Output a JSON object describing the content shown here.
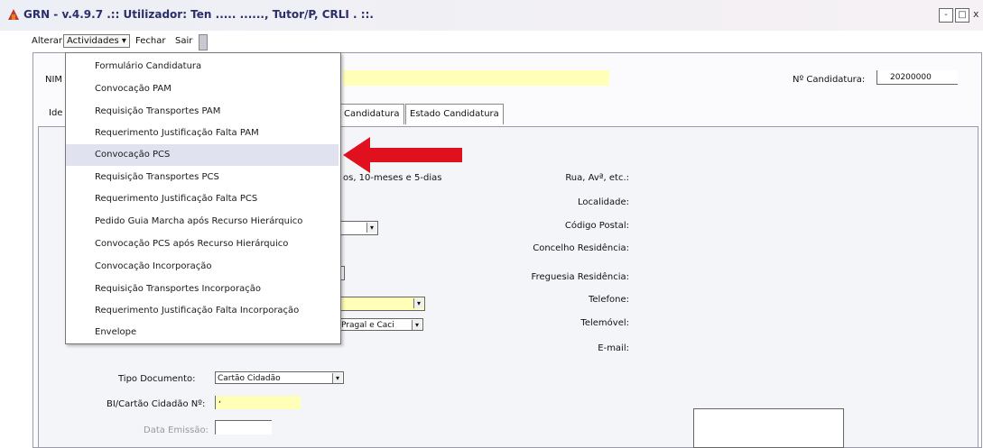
{
  "window": {
    "title": "GRN - v.4.9.7 .:: Utilizador: Ten ..... ......, Tutor/P, CRLI . ::.",
    "min_label": "-",
    "max_label": "□",
    "close_label": "x"
  },
  "menubar": {
    "alterar": "Alterar",
    "actividades": "Actividades ▾",
    "fechar": "Fechar",
    "sair": "Sair"
  },
  "header": {
    "nim_label": "NIM",
    "candidatura_label": "Nº Candidatura:",
    "candidatura_value": "20200000"
  },
  "tabs": [
    {
      "label": "Ide"
    },
    {
      "label": "Candidatura"
    },
    {
      "label": "Estado Candidatura"
    }
  ],
  "dropdown": {
    "items": [
      {
        "label": "Formulário Candidatura"
      },
      {
        "label": "Convocação PAM"
      },
      {
        "label": "Requisição Transportes PAM"
      },
      {
        "label": "Requerimento Justificação Falta PAM"
      },
      {
        "label": "Convocação PCS",
        "selected": true
      },
      {
        "label": "Requisição Transportes PCS"
      },
      {
        "label": "Requerimento Justificação Falta PCS"
      },
      {
        "label": "Pedido Guia Marcha após Recurso Hierárquico"
      },
      {
        "label": "Convocação PCS após Recurso Hierárquico"
      },
      {
        "label": "Convocação Incorporação"
      },
      {
        "label": "Requisição Transportes Incorporação"
      },
      {
        "label": "Requerimento Justificação Falta Incorporação"
      },
      {
        "label": "Envelope"
      }
    ]
  },
  "form": {
    "age_text": "os, 10-meses e 5-dias",
    "right_labels": [
      "Rua, Avª, etc.:",
      "Localidade:",
      "Código Postal:",
      "Concelho Residência:",
      "Freguesia Residência:",
      "Telefone:",
      "Telemóvel:",
      "E-mail:"
    ],
    "parish_value": "Pragal e Caci",
    "tipo_documento_label": "Tipo Documento:",
    "tipo_documento_value": "Cartão Cidadão",
    "bi_label": "BI/Cartão Cidadão Nº:",
    "bi_value": ",",
    "data_emissao_label": "Data Emissão:"
  },
  "colors": {
    "title_text": "#2a2e6a",
    "highlight": "#e1e2ef",
    "yellow_field": "#ffffb8",
    "arrow_red": "#e0101e"
  }
}
